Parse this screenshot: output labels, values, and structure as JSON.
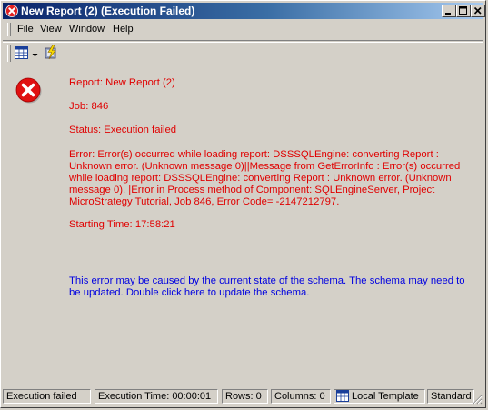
{
  "window": {
    "title": "New Report (2) (Execution Failed)"
  },
  "menu": {
    "file": "File",
    "view": "View",
    "window": "Window",
    "help": "Help"
  },
  "report": {
    "report_line": "Report: New Report (2)",
    "job_line": "Job: 846",
    "status_line": "Status: Execution failed",
    "error_text": "Error: Error(s) occurred while loading report: DSSSQLEngine: converting Report : Unknown error. (Unknown message 0)||Message from GetErrorInfo : Error(s) occurred while loading report: DSSSQLEngine: converting Report : Unknown error. (Unknown message 0). |Error in Process method of Component: SQLEngineServer, Project MicroStrategy Tutorial, Job 846, Error Code= -2147212797.",
    "starting_time": "Starting Time: 17:58:21",
    "schema_message": "This error may be caused by the current state of the schema. The schema may need to be updated. Double click here to update the schema."
  },
  "status_bar": {
    "state": "Execution failed",
    "execution_time": "Execution Time: 00:00:01",
    "rows": "Rows: 0",
    "columns": "Columns: 0",
    "template": "Local Template",
    "mode": "Standard"
  },
  "colors": {
    "error_text": "#e00000",
    "link_text": "#0000e0",
    "title_gradient_start": "#0a246a"
  },
  "icons": {
    "title": "error-x-icon",
    "message": "error-x-icon",
    "grid_view": "grid-icon",
    "run": "lightning-icon",
    "template": "template-icon"
  }
}
